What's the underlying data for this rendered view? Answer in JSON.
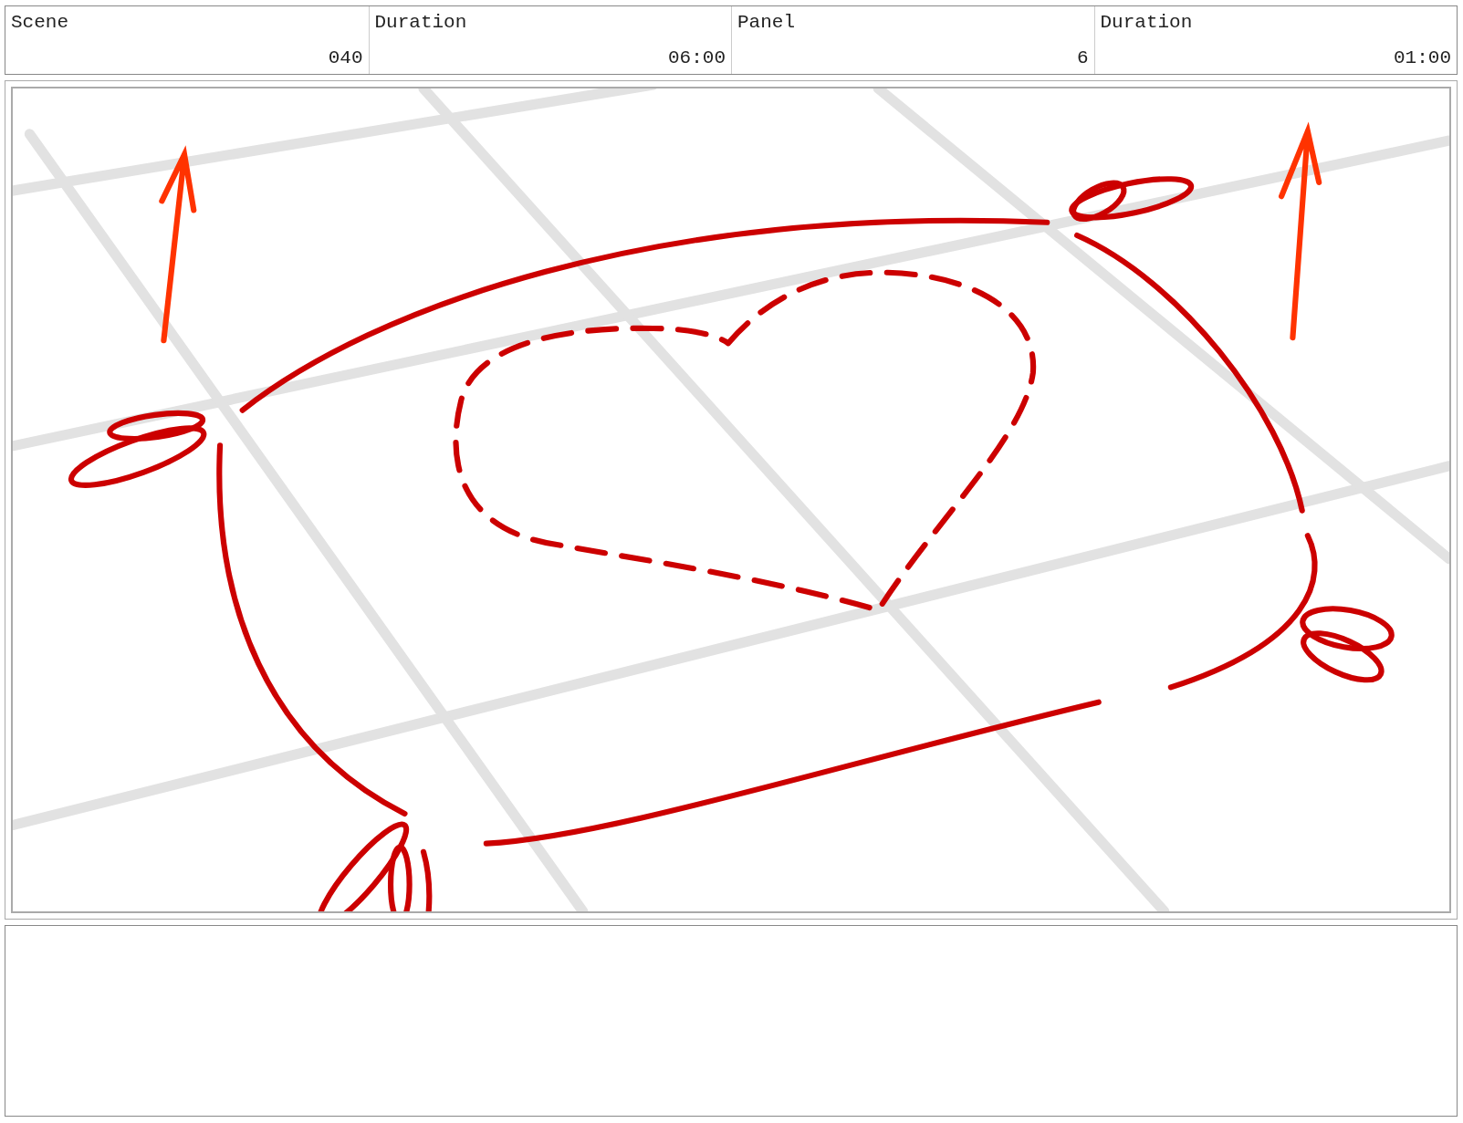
{
  "header": [
    {
      "kind": "label",
      "text": "Scene"
    },
    {
      "kind": "value",
      "text": "040"
    },
    {
      "kind": "label",
      "text": "Duration"
    },
    {
      "kind": "value",
      "text": "06:00"
    },
    {
      "kind": "label",
      "text": "Panel"
    },
    {
      "kind": "value",
      "text": "6"
    },
    {
      "kind": "label",
      "text": "Duration"
    },
    {
      "kind": "value",
      "text": "01:00"
    }
  ]
}
